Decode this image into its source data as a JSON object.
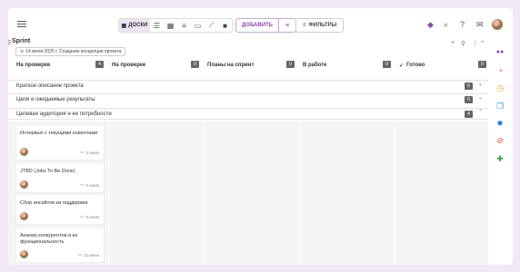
{
  "toolbar": {
    "views": [
      {
        "icon": "list-icon",
        "glyph": "☰"
      },
      {
        "icon": "grid-icon",
        "glyph": "▦"
      },
      {
        "icon": "sort-icon",
        "glyph": "≡"
      },
      {
        "icon": "calendar-icon",
        "glyph": "▭"
      },
      {
        "icon": "chart-icon",
        "glyph": "⟋"
      },
      {
        "icon": "square-icon",
        "glyph": "■"
      }
    ],
    "boards_label": "ДОСКИ",
    "add_label": "ДОБАВИТЬ",
    "filters_label": "ФИЛЬТРЫ"
  },
  "sprint": {
    "title": "Sprint",
    "tag": "14 июня 2025 г. Создание концепции проекта"
  },
  "columns": [
    {
      "label": "На проверке",
      "count": "4"
    },
    {
      "label": "На проверке",
      "count": "0"
    },
    {
      "label": "Планы на спринт",
      "count": "0"
    },
    {
      "label": "В работе",
      "count": "0"
    },
    {
      "label": "Готово",
      "count": "0",
      "check": "✓"
    }
  ],
  "sections": [
    {
      "label": "Краткое описание проекта",
      "count": "0"
    },
    {
      "label": "Цели и ожидаемые результаты",
      "count": "0"
    },
    {
      "label": "Целевая аудитория и ее потребности",
      "count": "4"
    }
  ],
  "cards": [
    {
      "title": "Интервью с текущими клиентами",
      "date": "2 июня"
    },
    {
      "title": "JTBD (Jobs To Be Done)",
      "date": "5 июня"
    },
    {
      "title": "Сбор инсайтов из поддержки",
      "date": "9 июня"
    },
    {
      "title": "Анализ конкурентов и их функциональность",
      "date": "12 июня"
    }
  ],
  "sidebar_icons": [
    {
      "name": "people-icon",
      "glyph": "👥",
      "color": "#8a4ca8"
    },
    {
      "name": "history-icon",
      "glyph": "◔",
      "color": "#e5533d"
    },
    {
      "name": "clock-icon",
      "glyph": "◷",
      "color": "#f0a030"
    },
    {
      "name": "copy-icon",
      "glyph": "❐",
      "color": "#2aa0d8"
    },
    {
      "name": "badge-icon",
      "glyph": "✹",
      "color": "#1e7be0"
    },
    {
      "name": "block-icon",
      "glyph": "⊘",
      "color": "#e5533d"
    },
    {
      "name": "puzzle-icon",
      "glyph": "✚",
      "color": "#2e9e4a"
    }
  ]
}
